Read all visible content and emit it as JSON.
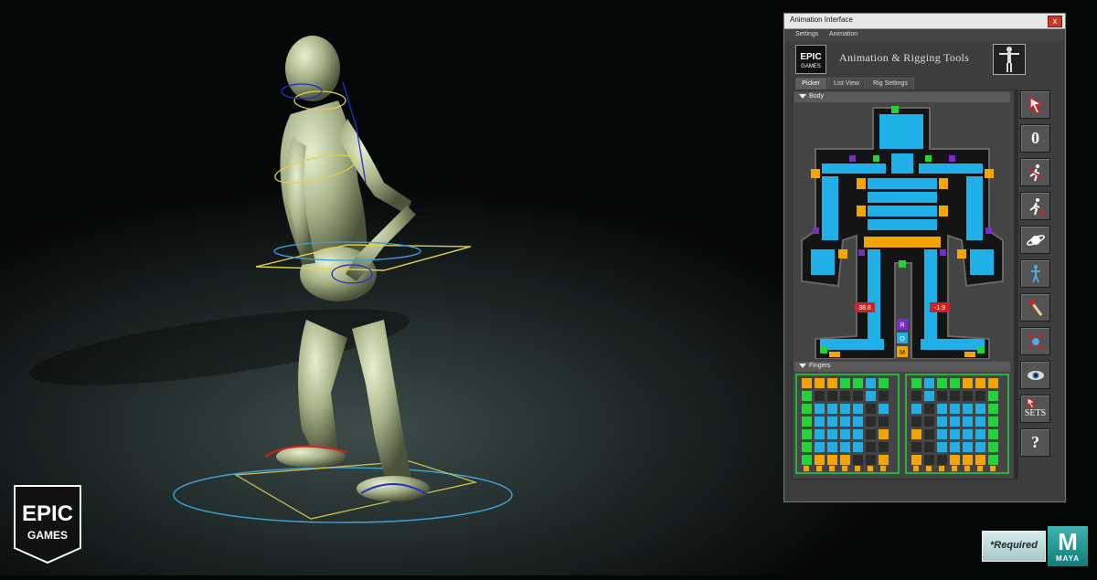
{
  "window": {
    "title": "Animation Interface",
    "close_glyph": "x",
    "menu": [
      "Settings",
      "Animation"
    ],
    "banner_title": "Animation & Rigging Tools",
    "tabs": [
      "Picker",
      "List View",
      "Rig Settings"
    ],
    "active_tab": "Picker",
    "sections": {
      "body": "Body",
      "fingers": "Fingers"
    },
    "leg_values": {
      "left": "38.8",
      "right": "-1.9"
    },
    "rom_labels": [
      "R",
      "O",
      "M"
    ],
    "toolbar": [
      {
        "icon": "select-arrow-icon"
      },
      {
        "icon": "zero-icon",
        "glyph": "0"
      },
      {
        "icon": "run-mirror-icon"
      },
      {
        "icon": "run-key-icon"
      },
      {
        "icon": "space-switch-icon"
      },
      {
        "icon": "pose-figure-icon"
      },
      {
        "icon": "match-tool-icon"
      },
      {
        "icon": "reset-pose-icon"
      },
      {
        "icon": "visibility-eye-icon"
      },
      {
        "icon": "selection-sets-icon",
        "glyph": "SETS"
      },
      {
        "icon": "help-icon",
        "glyph": "?"
      }
    ],
    "colors": {
      "control_blue": "#1fb0e8",
      "control_orange": "#f4a500",
      "control_green": "#22d43a",
      "control_purple": "#7a2bc8",
      "value_red": "#d42020"
    }
  },
  "logos": {
    "epic_line1": "EPIC",
    "epic_line2": "GAMES"
  },
  "badges": {
    "required": "*Required",
    "maya_letter": "M",
    "maya_text": "MAYA"
  }
}
